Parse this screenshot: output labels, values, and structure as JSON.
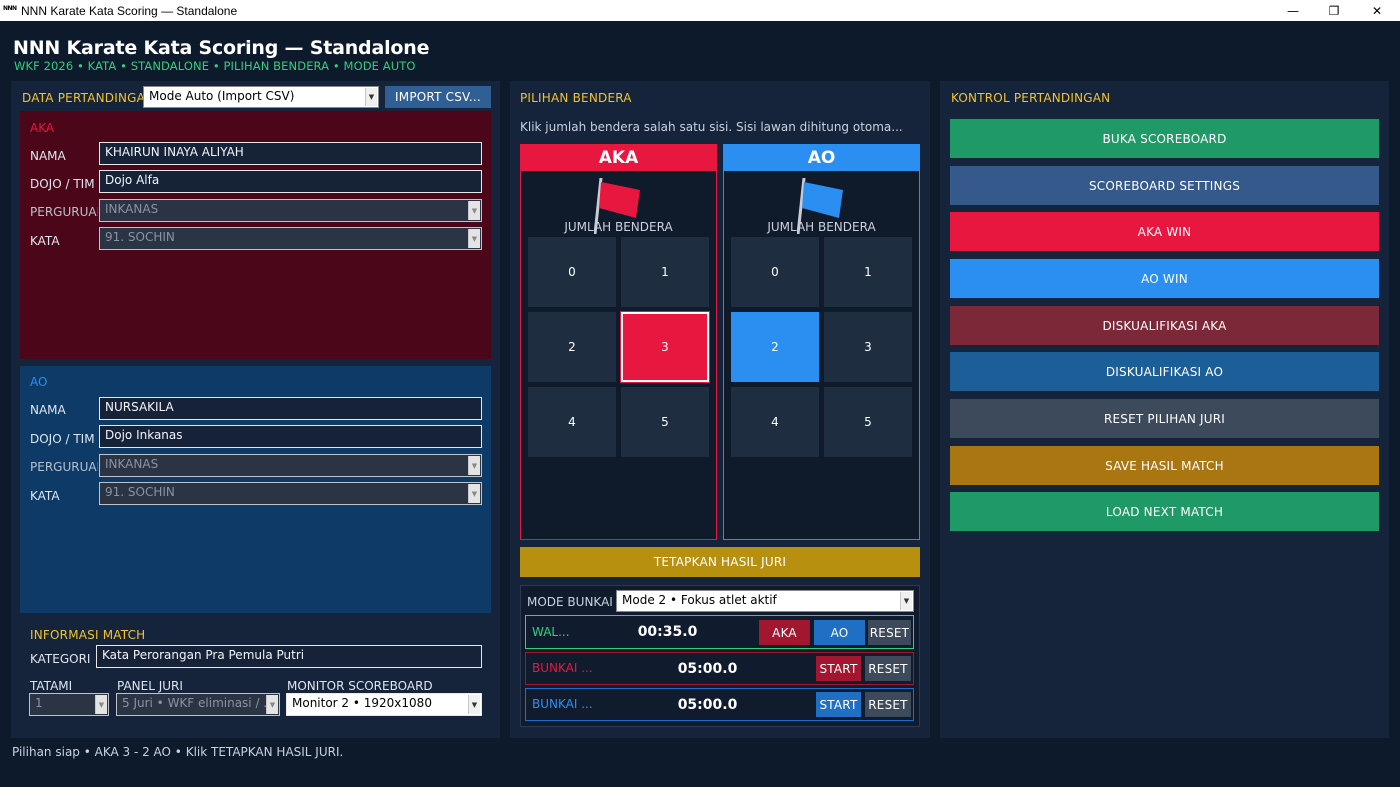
{
  "window": {
    "logo_text": "NNN",
    "title": "NNN Karate Kata Scoring — Standalone",
    "minimize": "—",
    "maximize": "❐",
    "close": "✕"
  },
  "app": {
    "title": "NNN Karate Kata Scoring — Standalone",
    "subtitle": "WKF 2026 • KATA • STANDALONE • PILIHAN BENDERA • MODE AUTO"
  },
  "data_panel": {
    "title": "DATA PERTANDINGAN",
    "mode_value": "Mode Auto (Import CSV)",
    "import_button": "IMPORT CSV...",
    "aka": {
      "title": "AKA",
      "nama_label": "NAMA",
      "nama_value": "KHAIRUN INAYA ALIYAH",
      "dojo_label": "DOJO / TIM",
      "dojo_value": "Dojo Alfa",
      "perguruan_label": "PERGURUAN",
      "perguruan_value": "INKANAS",
      "kata_label": "KATA",
      "kata_value": "91. SOCHIN"
    },
    "ao": {
      "title": "AO",
      "nama_label": "NAMA",
      "nama_value": "NURSAKILA",
      "dojo_label": "DOJO / TIM",
      "dojo_value": "Dojo Inkanas",
      "perguruan_label": "PERGURUAN",
      "perguruan_value": "INKANAS",
      "kata_label": "KATA",
      "kata_value": "91. SOCHIN"
    },
    "match_info": {
      "title": "INFORMASI MATCH",
      "kategori_label": "KATEGORI",
      "kategori_value": "Kata Perorangan Pra Pemula Putri",
      "tatami_label": "TATAMI",
      "tatami_value": "1",
      "panel_label": "PANEL JURI",
      "panel_value": "5 Juri • WKF eliminasi / ...",
      "monitor_label": "MONITOR SCOREBOARD",
      "monitor_value": "Monitor 2 • 1920x1080"
    }
  },
  "flag_panel": {
    "title": "PILIHAN BENDERA",
    "instruction": "Klik jumlah bendera salah satu sisi. Sisi lawan dihitung otoma...",
    "aka": {
      "header": "AKA",
      "sub": "JUMLAH BENDERA",
      "options": [
        "0",
        "1",
        "2",
        "3",
        "4",
        "5"
      ],
      "selected": "3"
    },
    "ao": {
      "header": "AO",
      "sub": "JUMLAH BENDERA",
      "options": [
        "0",
        "1",
        "2",
        "3",
        "4",
        "5"
      ],
      "selected": "2"
    },
    "tetapkan_button": "TETAPKAN HASIL JURI",
    "bunkai_mode_label": "MODE BUNKAI",
    "bunkai_mode_value": "Mode 2 • Fokus atlet aktif",
    "timers": {
      "wal_label": "WAL...",
      "wal_time": "00:35.0",
      "wal_aka": "AKA",
      "wal_ao": "AO",
      "wal_reset": "RESET",
      "bunkai_aka_label": "BUNKAI ...",
      "bunkai_aka_time": "05:00.0",
      "bunkai_aka_start": "START",
      "bunkai_aka_reset": "RESET",
      "bunkai_ao_label": "BUNKAI ...",
      "bunkai_ao_time": "05:00.0",
      "bunkai_ao_start": "START",
      "bunkai_ao_reset": "RESET"
    }
  },
  "control_panel": {
    "title": "KONTROL PERTANDINGAN",
    "buttons": [
      {
        "label": "BUKA SCOREBOARD",
        "color": "#1f9a66"
      },
      {
        "label": "SCOREBOARD SETTINGS",
        "color": "#34598a"
      },
      {
        "label": "AKA WIN",
        "color": "#e8173f"
      },
      {
        "label": "AO WIN",
        "color": "#2a8ff0"
      },
      {
        "label": "DISKUALIFIKASI AKA",
        "color": "#7d2838"
      },
      {
        "label": "DISKUALIFIKASI AO",
        "color": "#1c5e98"
      },
      {
        "label": "RESET PILIHAN JURI",
        "color": "#3d4a5c"
      },
      {
        "label": "SAVE HASIL MATCH",
        "color": "#aa7612"
      },
      {
        "label": "LOAD NEXT MATCH",
        "color": "#1f9a66"
      }
    ]
  },
  "status": "Pilihan siap • AKA 3 - 2 AO • Klik TETAPKAN HASIL JURI.",
  "colors": {
    "aka": "#e8173f",
    "ao": "#2a8ff0",
    "accent_green": "#2fd07e",
    "section_title": "#f2c230"
  }
}
